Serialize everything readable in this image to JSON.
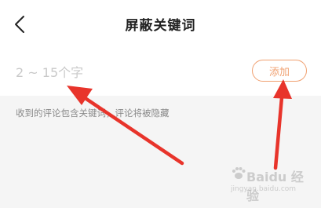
{
  "header": {
    "title": "屏蔽关键词",
    "back_icon": "chevron-left-icon"
  },
  "keyword_input": {
    "placeholder": "2 ~ 15个字",
    "value": ""
  },
  "add_button": {
    "label": "添加"
  },
  "hint": {
    "text": "收到的评论包含关键词，评论将被隐藏"
  },
  "watermark": {
    "main_text": "Baidu 经验",
    "sub_text": "jingyan.baidu.com"
  },
  "colors": {
    "accent": "#f0a070",
    "arrow": "#e8342b",
    "hint_bg": "#f5f5f5"
  }
}
